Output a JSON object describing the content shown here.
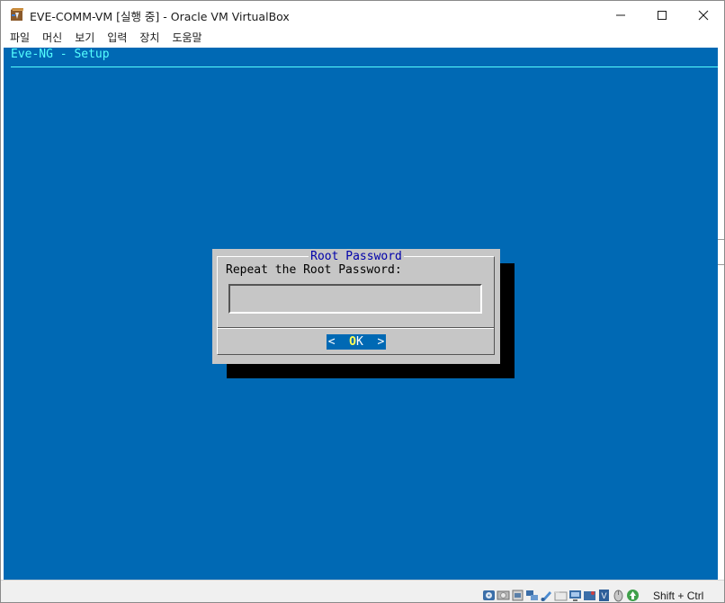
{
  "window": {
    "title": "EVE-COMM-VM [실행 중] - Oracle VM VirtualBox",
    "app_icon": "virtualbox-icon"
  },
  "menu": {
    "items": [
      {
        "label": "파일"
      },
      {
        "label": "머신"
      },
      {
        "label": "보기"
      },
      {
        "label": "입력"
      },
      {
        "label": "장치"
      },
      {
        "label": "도움말"
      }
    ]
  },
  "console": {
    "header": "Eve-NG - Setup",
    "background_color": "#0069b4",
    "header_color": "#55ffff"
  },
  "dialog": {
    "title": "Root Password",
    "prompt": "Repeat the Root Password:",
    "password_value": "",
    "ok_left": "<  ",
    "ok_hotkey": "O",
    "ok_rest": "K  >"
  },
  "statusbar": {
    "icons": [
      "hard-disk-icon",
      "optical-drive-icon",
      "audio-icon",
      "network-icon",
      "usb-icon",
      "shared-folders-icon",
      "display-icon",
      "video-capture-icon",
      "cpu-icon",
      "mouse-integration-icon",
      "keyboard-capture-icon"
    ],
    "host_key": "Shift + Ctrl"
  }
}
